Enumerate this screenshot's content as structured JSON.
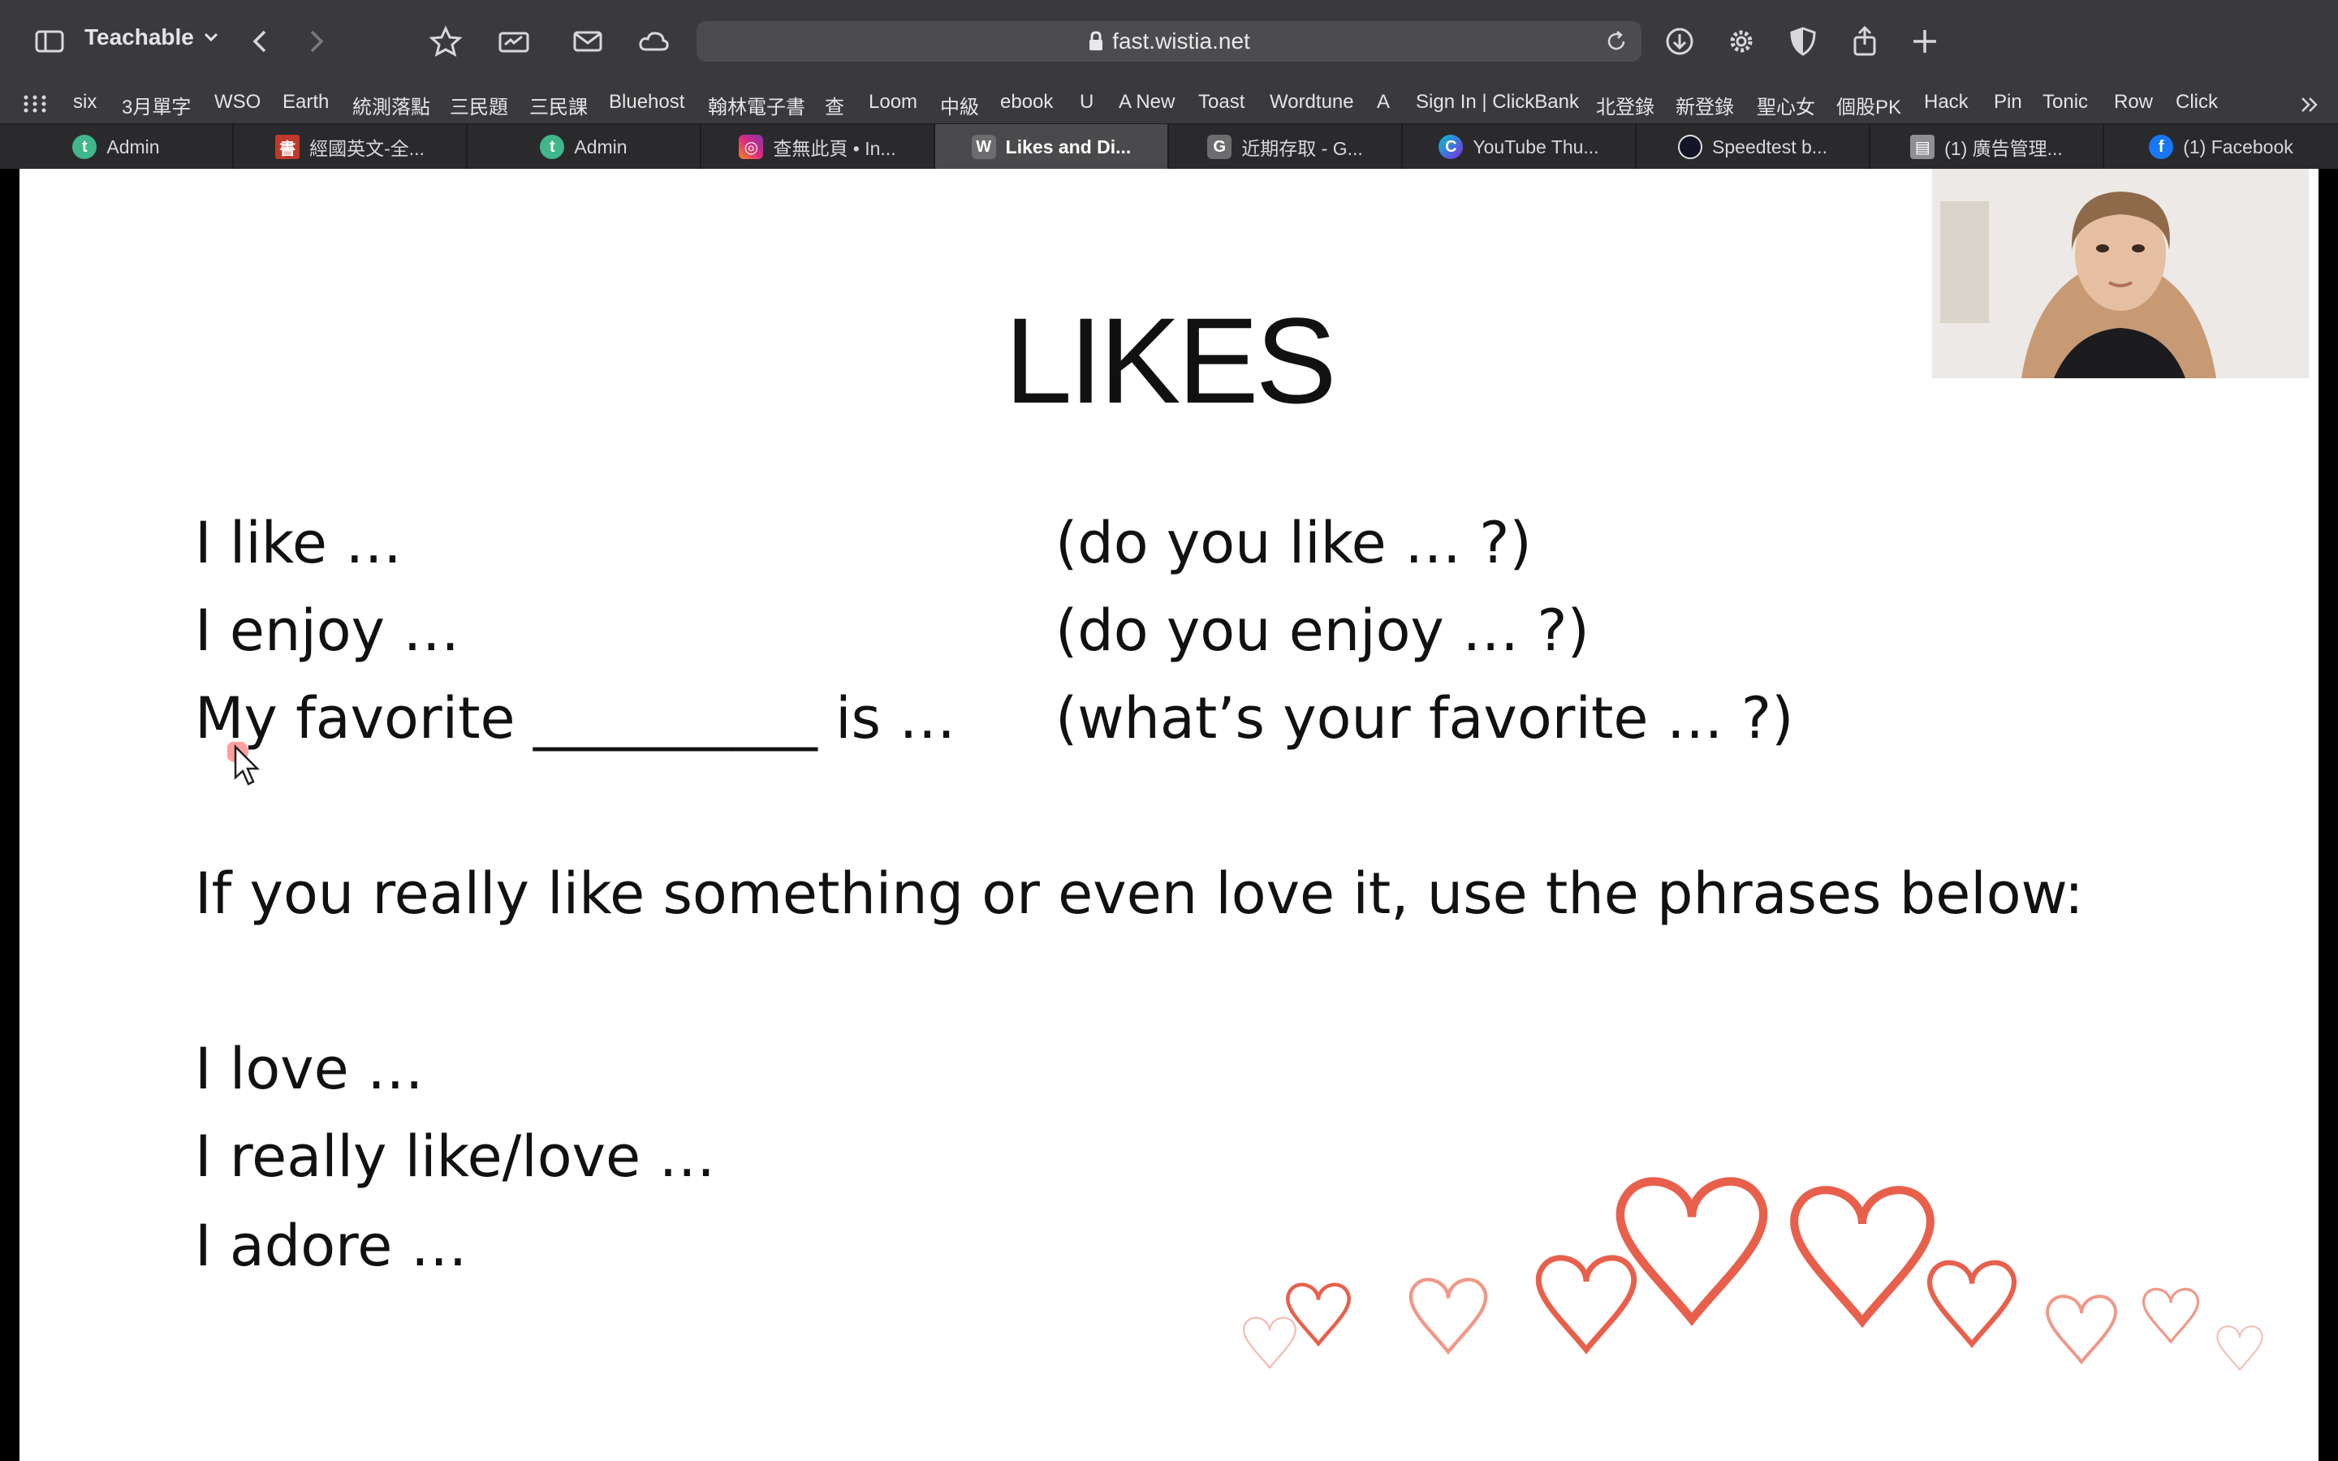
{
  "toolbar": {
    "profile": "Teachable",
    "url": "fast.wistia.net"
  },
  "bookmarks": [
    "six",
    "3月單字",
    "WSO",
    "Earth",
    "統測落點",
    "三民題",
    "三民課",
    "Bluehost",
    "翰林電子書",
    "查",
    "Loom",
    "中級",
    "ebook",
    "U",
    "A New",
    "Toast",
    "Wordtune",
    "A",
    "Sign In | ClickBank",
    "北登錄",
    "新登錄",
    "聖心女",
    "個股PK",
    "Hack",
    "Pin",
    "Tonic",
    "Row",
    "Click"
  ],
  "tabs": [
    {
      "label": "Admin",
      "icon": "teachable-icon",
      "color": "#3fb68b"
    },
    {
      "label": "經國英文-全...",
      "icon": "book-icon",
      "color": "#c0392b"
    },
    {
      "label": "Admin",
      "icon": "teachable-icon",
      "color": "#3fb68b"
    },
    {
      "label": "查無此頁 • In...",
      "icon": "instagram-icon",
      "color": "#d6249f"
    },
    {
      "label": "Likes and Di...",
      "icon": "wistia-icon",
      "color": "#6d6d6f"
    },
    {
      "label": "近期存取 - G...",
      "icon": "g-icon",
      "color": "#6d6d6f"
    },
    {
      "label": "YouTube Thu...",
      "icon": "canva-icon",
      "color": "#7d2ae8"
    },
    {
      "label": "Speedtest b...",
      "icon": "speedtest-icon",
      "color": "#141526"
    },
    {
      "label": "(1) 廣告管理...",
      "icon": "ads-icon",
      "color": "#8e8e93"
    },
    {
      "label": "(1) Facebook",
      "icon": "facebook-icon",
      "color": "#1877f2"
    }
  ],
  "slide": {
    "title": "LIKES",
    "left_lines": [
      "I like …",
      "I enjoy …",
      "My favorite __________ is …"
    ],
    "right_lines": [
      "(do you like … ?)",
      "(do you enjoy … ?)",
      "(what’s your favorite … ?)"
    ],
    "middle": "If you really like something or even love it, use the phrases below:",
    "bottom_lines": [
      "I love …",
      "I really like/love …",
      "I adore …"
    ],
    "heart_color": "#e8604c"
  }
}
